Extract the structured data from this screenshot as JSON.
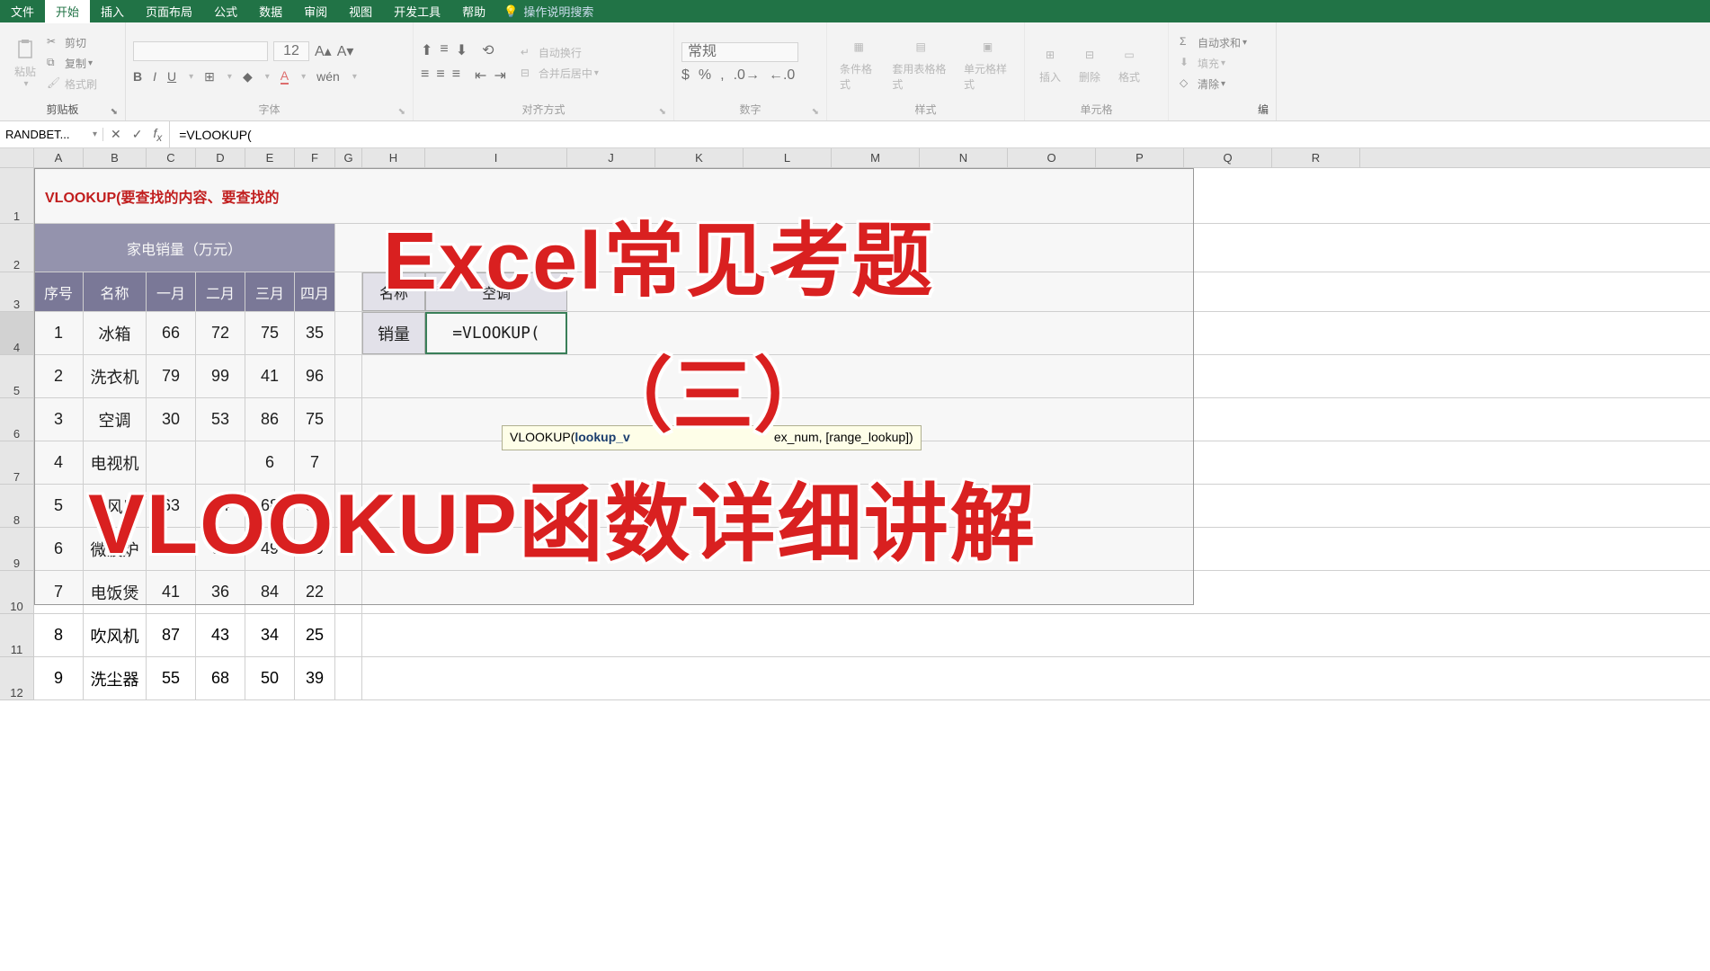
{
  "tabs": [
    "文件",
    "开始",
    "插入",
    "页面布局",
    "公式",
    "数据",
    "审阅",
    "视图",
    "开发工具",
    "帮助"
  ],
  "activeTab": 1,
  "helpSearch": "操作说明搜索",
  "ribbon": {
    "clipboard": {
      "paste": "粘贴",
      "cut": "剪切",
      "copy": "复制",
      "brush": "格式刷",
      "label": "剪贴板"
    },
    "font": {
      "size": "12",
      "label": "字体"
    },
    "align": {
      "wrap": "自动换行",
      "merge": "合并后居中",
      "label": "对齐方式"
    },
    "number": {
      "format": "常规",
      "label": "数字"
    },
    "styles": {
      "cond": "条件格式",
      "table": "套用表格格式",
      "cell": "单元格样式",
      "label": "样式"
    },
    "cells": {
      "insert": "插入",
      "delete": "删除",
      "format": "格式",
      "label": "单元格"
    },
    "editing": {
      "sum": "自动求和",
      "fill": "填充",
      "clear": "清除",
      "label": "编"
    }
  },
  "formulaBar": {
    "nameBox": "RANDBET...",
    "formula": "=VLOOKUP("
  },
  "colHeaders": [
    "A",
    "B",
    "C",
    "D",
    "E",
    "F",
    "G",
    "H",
    "I",
    "J",
    "K",
    "L",
    "M",
    "N",
    "O",
    "P",
    "Q",
    "R"
  ],
  "rowCount": 12,
  "note": "VLOOKUP(要查找的内容、要查找的",
  "tableTitle": "家电销量（万元）",
  "headers": [
    "序号",
    "名称",
    "一月",
    "二月",
    "三月",
    "四月"
  ],
  "rows": [
    [
      "1",
      "冰箱",
      "66",
      "72",
      "75",
      "35"
    ],
    [
      "2",
      "洗衣机",
      "79",
      "99",
      "41",
      "96"
    ],
    [
      "3",
      "空调",
      "30",
      "53",
      "86",
      "75"
    ],
    [
      "4",
      "电视机",
      "",
      "",
      "6",
      "7"
    ],
    [
      "5",
      "电风扇",
      "63",
      "74",
      "68",
      "51"
    ],
    [
      "6",
      "微波炉",
      "28",
      "66",
      "49",
      "29"
    ],
    [
      "7",
      "电饭煲",
      "41",
      "36",
      "84",
      "22"
    ],
    [
      "8",
      "吹风机",
      "87",
      "43",
      "34",
      "25"
    ],
    [
      "9",
      "洗尘器",
      "55",
      "68",
      "50",
      "39"
    ]
  ],
  "lookupBox": {
    "nameLabel": "名称",
    "nameValue": "空调",
    "salesLabel": "销量",
    "salesValue": "=VLOOKUP("
  },
  "tooltip": {
    "pre": "VLOOKUP(",
    "bold": "lookup_v",
    "post": "ex_num, [range_lookup])"
  },
  "overlay": {
    "l1": "Excel常见考题",
    "l2": "（三）",
    "l3": "VLOOKUP函数详细讲解"
  }
}
